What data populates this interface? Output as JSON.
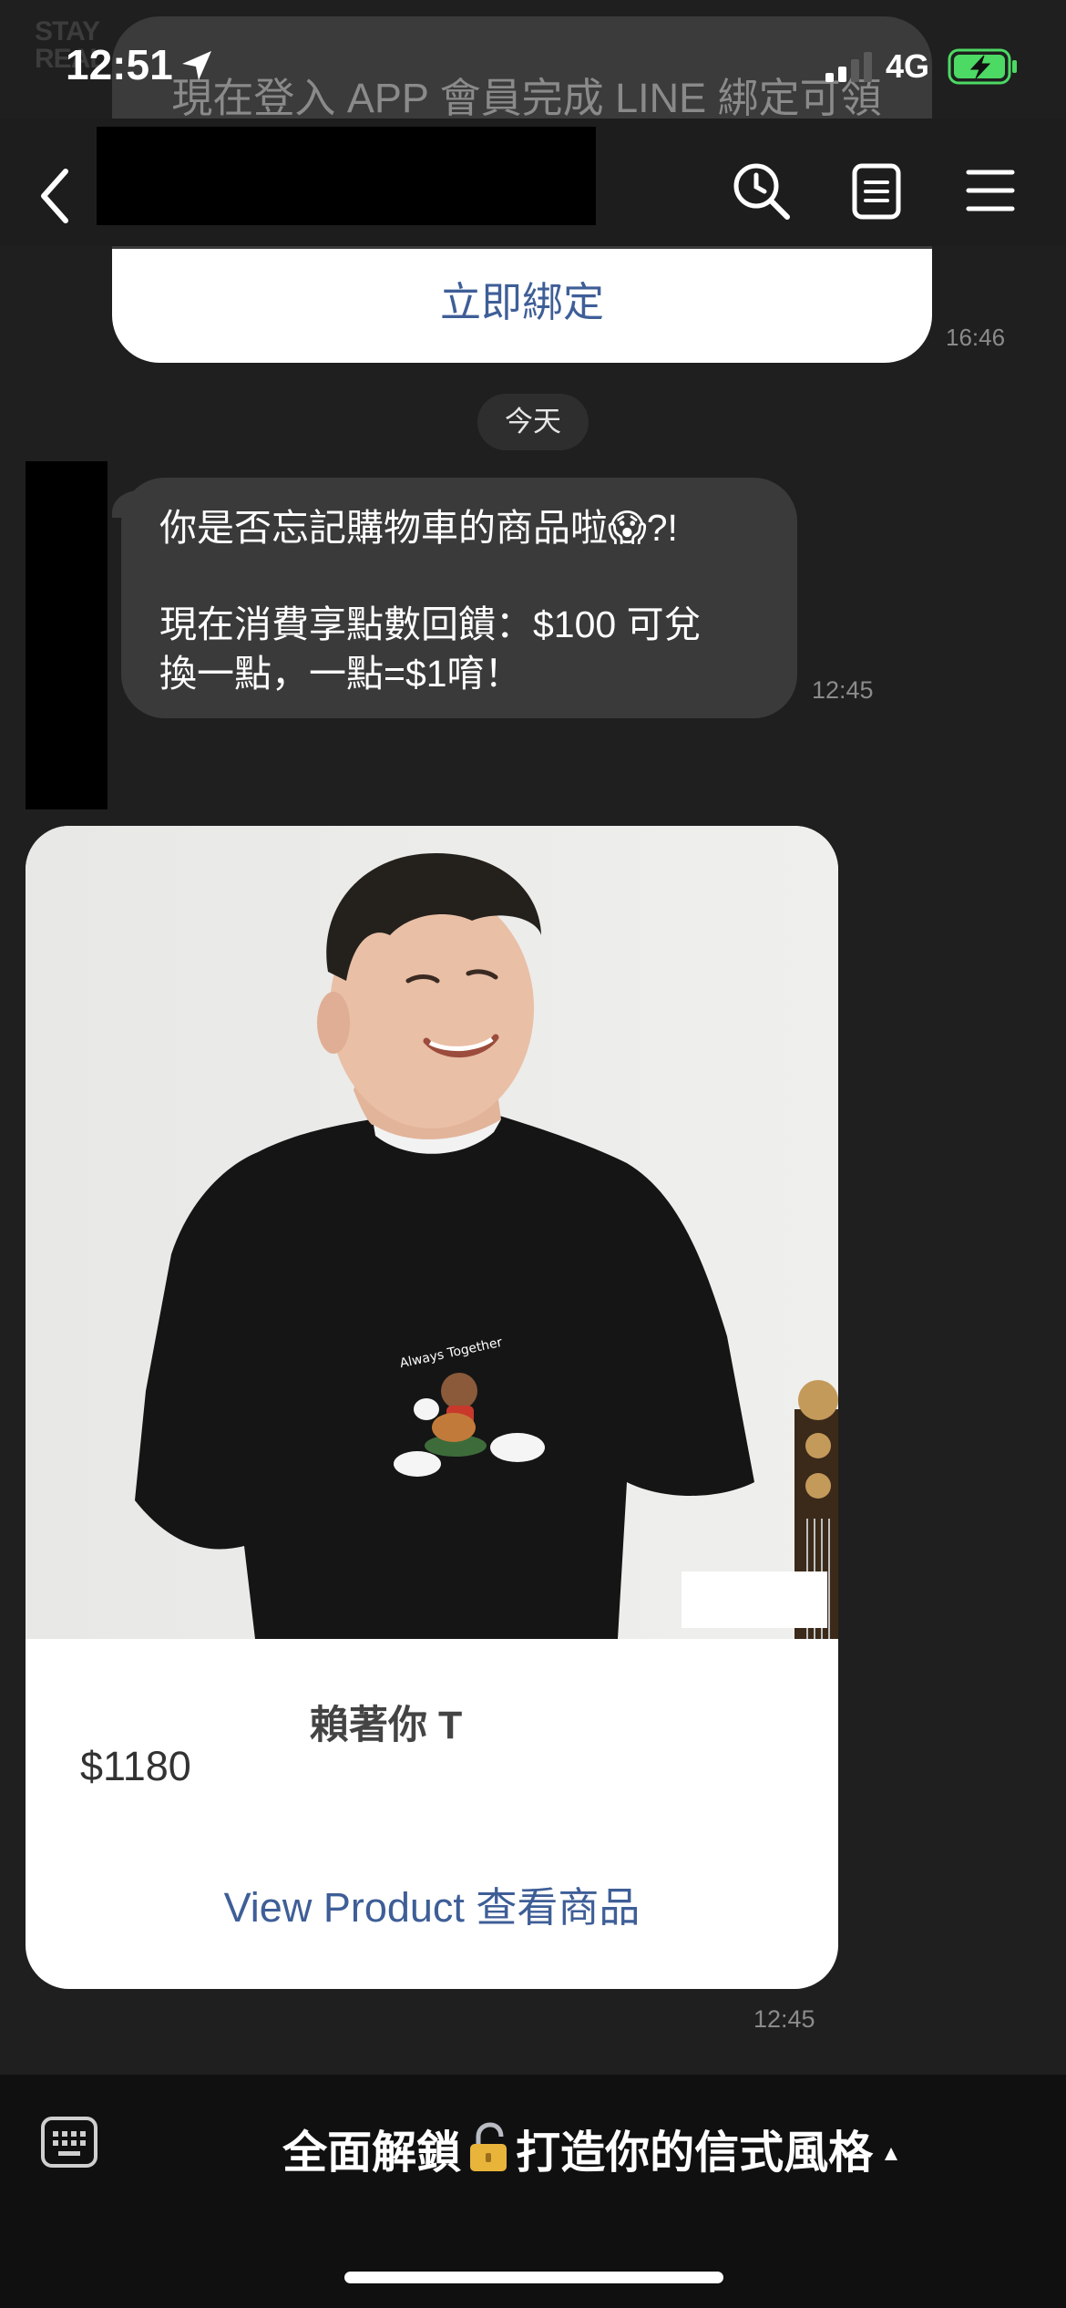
{
  "status_bar": {
    "watermark": "STAY\nREAL",
    "time": "12:51",
    "network": "4G"
  },
  "previous_message": {
    "text": "現在登入 APP 會員完成 LINE 綁定可領現用！",
    "button_label": "立即綁定",
    "time": "16:46"
  },
  "date_separator": "今天",
  "message": {
    "line1": "你是否忘記購物車的商品啦😱?!",
    "line2": "現在消費享點數回饋：$100 可兌",
    "line3": "換一點，一點=$1唷！",
    "time": "12:45"
  },
  "product_card": {
    "title": "賴著你 T",
    "price": "$1180",
    "link_label": "View Product 查看商品",
    "time": "12:45",
    "shirt_print": "Always Together"
  },
  "bottom_bar": {
    "rich_menu_label_pre": "全面解鎖",
    "rich_menu_label_post": "打造你的信式風格",
    "caret": "▲"
  },
  "icons": [
    "location-arrow-icon",
    "signal-icon",
    "battery-charging-icon",
    "back-chevron-icon",
    "search-icon",
    "notes-icon",
    "menu-icon",
    "keyboard-icon",
    "lock-icon"
  ],
  "colors": {
    "background": "#1f1f1f",
    "bubble": "#3a3a3a",
    "link": "#3e5e97",
    "battery": "#4cd964"
  }
}
